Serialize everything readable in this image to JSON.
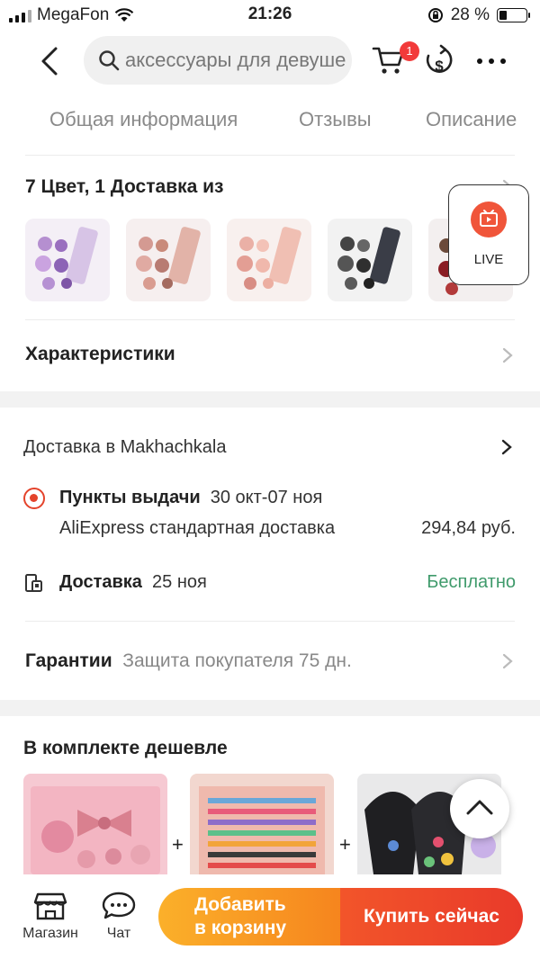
{
  "status_bar": {
    "carrier": "MegaFon",
    "time": "21:26",
    "battery_text": "28 %",
    "battery_level": 0.28
  },
  "nav": {
    "search_text": "аксессуары для девуше",
    "cart_count": "1",
    "icons": [
      "back-icon",
      "search-icon",
      "cart-icon",
      "coin-icon",
      "more-icon"
    ]
  },
  "tabs": [
    "Общая информация",
    "Отзывы",
    "Описание"
  ],
  "variants": {
    "title": "7 Цвет, 1 Доставка из",
    "live_label": "LIVE"
  },
  "specs": {
    "title": "Характеристики"
  },
  "delivery": {
    "header": "Доставка в Makhachkala",
    "pickup_label": "Пункты выдачи",
    "pickup_dates": "30 окт-07 ноя",
    "pickup_method": "AliExpress стандартная доставка",
    "pickup_price": "294,84 руб.",
    "courier_label": "Доставка",
    "courier_date": "25 ноя",
    "courier_price": "Бесплатно"
  },
  "guarantee": {
    "title": "Гарантии",
    "text": "Защита покупателя 75 дн."
  },
  "bundle": {
    "title": "В комплекте дешевле",
    "plus": "+"
  },
  "bottom_bar": {
    "store_label": "Магазин",
    "chat_label": "Чат",
    "add_to_cart_line1": "Добавить",
    "add_to_cart_line2": "в корзину",
    "buy_now": "Купить сейчас"
  },
  "colors": {
    "accent_red": "#e4432b",
    "free_green": "#3f9a6b",
    "cta_orange": "#f6851e",
    "cta_red": "#e93a2a"
  }
}
